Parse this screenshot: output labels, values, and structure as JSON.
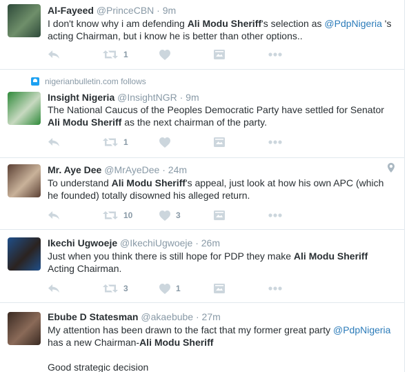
{
  "tweets": [
    {
      "fullname": "Al-Fayeed",
      "handle": "@PrinceCBN",
      "time": "9m",
      "text_parts": [
        {
          "t": "I don't know why i am defending "
        },
        {
          "t": "Ali Modu Sheriff",
          "b": true
        },
        {
          "t": "'s selection as "
        },
        {
          "t": "@PdpNigeria",
          "m": true
        },
        {
          "t": " 's acting Chairman, but i know he is better than other options.."
        }
      ],
      "retweets": "1",
      "likes": "",
      "avatar_colors": [
        "#2e4a3a",
        "#6f8f6a"
      ]
    },
    {
      "context": "nigerianbulletin.com follows",
      "fullname": "Insight Nigeria",
      "handle": "@InsightNGR",
      "time": "9m",
      "text_parts": [
        {
          "t": "The National Caucus of the Peoples Democratic Party have settled for Senator "
        },
        {
          "t": "Ali Modu Sheriff",
          "b": true
        },
        {
          "t": " as the next chairman of the party."
        }
      ],
      "retweets": "1",
      "likes": "",
      "avatar_colors": [
        "#2f8a3a",
        "#c7d9c0"
      ]
    },
    {
      "fullname": "Mr. Aye Dee",
      "handle": "@MrAyeDee",
      "time": "24m",
      "text_parts": [
        {
          "t": "To understand "
        },
        {
          "t": "Ali Modu Sheriff",
          "b": true
        },
        {
          "t": "'s appeal, just look at how his own APC (which he founded) totally disowned his alleged return."
        }
      ],
      "retweets": "10",
      "likes": "3",
      "geo": true,
      "avatar_colors": [
        "#5b4034",
        "#c9b29a"
      ]
    },
    {
      "fullname": "Ikechi Ugwoeje",
      "handle": "@IkechiUgwoeje",
      "time": "26m",
      "text_parts": [
        {
          "t": "Just when you think there is still hope for PDP they make "
        },
        {
          "t": "Ali Modu Sheriff",
          "b": true
        },
        {
          "t": " Acting Chairman."
        }
      ],
      "retweets": "3",
      "likes": "1",
      "avatar_colors": [
        "#1f4f8a",
        "#2b2320"
      ]
    },
    {
      "fullname": "Ebube D Statesman",
      "handle": "@akaebube",
      "time": "27m",
      "text_parts": [
        {
          "t": "My attention has been drawn to the fact that my former great party "
        },
        {
          "t": "@PdpNigeria",
          "m": true
        },
        {
          "t": " has a new Chairman-"
        },
        {
          "t": "Ali Modu Sheriff",
          "b": true
        },
        {
          "br": true
        },
        {
          "br": true
        },
        {
          "t": "Good strategic decision"
        }
      ],
      "retweets": "",
      "likes": "",
      "avatar_colors": [
        "#3a2a22",
        "#8a6a58"
      ]
    }
  ],
  "colors": {
    "text": "#292f33",
    "muted": "#8899a6",
    "link": "#2b7bb9",
    "action_icon": "#ccd6dd",
    "divider": "#e1e8ed"
  },
  "icons": [
    "reply-icon",
    "retweet-icon",
    "like-icon",
    "dm-icon",
    "more-icon",
    "location-icon",
    "follows-icon"
  ]
}
